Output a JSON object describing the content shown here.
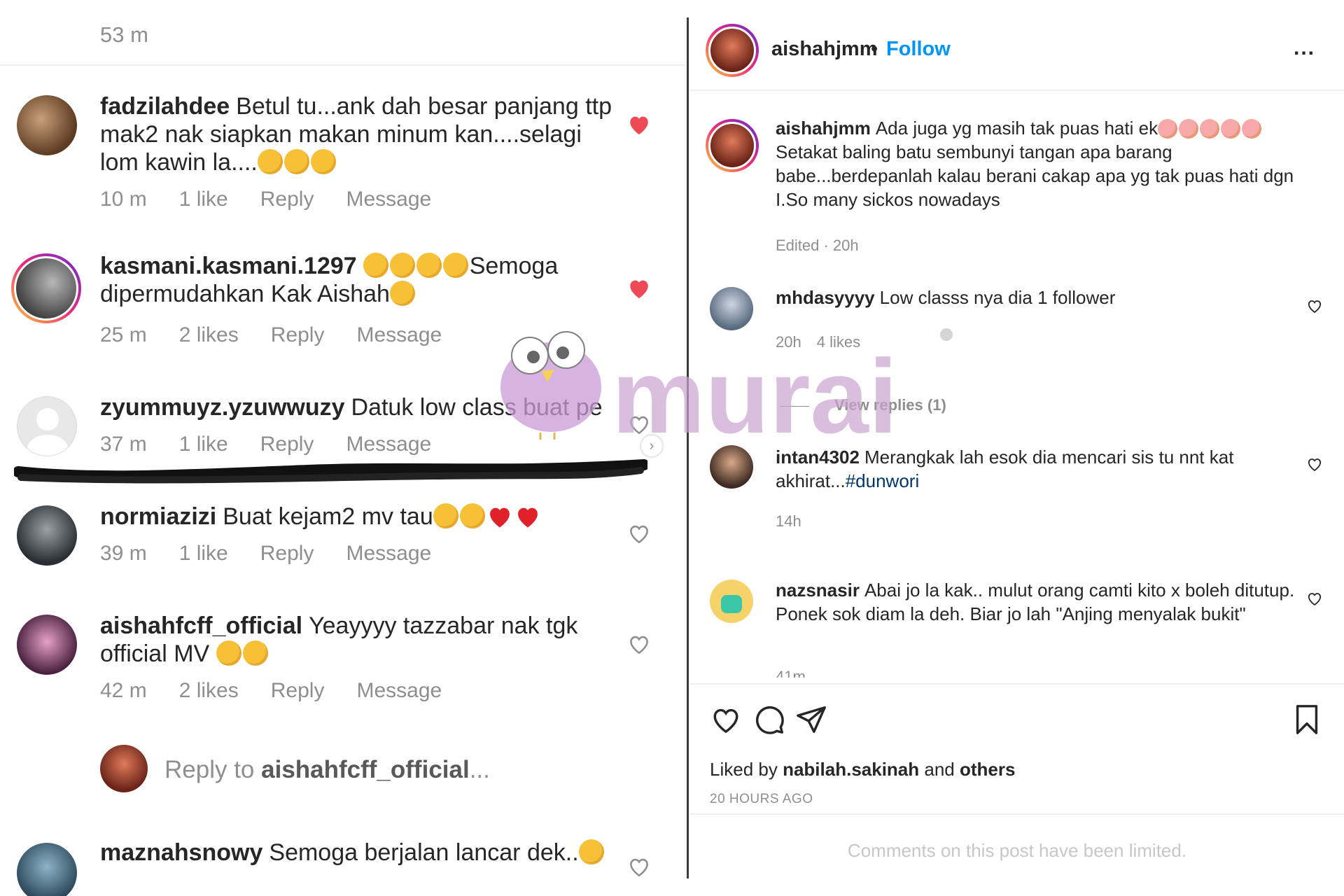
{
  "left_panel": {
    "top_timestamp": "53 m",
    "comments": [
      {
        "username": "fadzilahdee",
        "text": "Betul tu...ank dah besar panjang ttp mak2 nak siapkan makan minum kan....selagi lom kawin la....",
        "emojis": [
          "grinning-sweat",
          "grinning-sweat",
          "grinning-sweat"
        ],
        "time": "10 m",
        "likes": "1 like",
        "reply": "Reply",
        "message": "Message",
        "liked": true
      },
      {
        "username": "kasmani.kasmani.1297",
        "text": "Semoga dipermudahkan Kak Aishah",
        "emojis": [
          "grinning",
          "grinning-sweat",
          "grinning-sweat",
          "rofl",
          "grinning-sweat"
        ],
        "time": "25 m",
        "likes": "2 likes",
        "reply": "Reply",
        "message": "Message",
        "liked": true
      },
      {
        "username": "zyummuyz.yzuwwuzy",
        "text": "Datuk low class buat pe",
        "time": "37 m",
        "likes": "1 like",
        "reply": "Reply",
        "message": "Message",
        "liked": false
      },
      {
        "username": "normiazizi",
        "text": "Buat kejam2 mv tau",
        "emojis": [
          "grinning-sweat",
          "grinning-sweat",
          "red-heart",
          "red-heart"
        ],
        "time": "39 m",
        "likes": "1 like",
        "reply": "Reply",
        "message": "Message",
        "liked": false
      },
      {
        "username": "aishahfcff_official",
        "text": "Yeayyyy tazzabar nak tgk official MV",
        "emojis": [
          "heart-eyes",
          "heart-eyes"
        ],
        "time": "42 m",
        "likes": "2 likes",
        "reply": "Reply",
        "message": "Message",
        "liked": false
      },
      {
        "username": "maznahsnowy",
        "text": "Semoga berjalan lancar dek..",
        "emojis": [
          "thumbs-up"
        ],
        "liked": false
      }
    ],
    "reply_prompt": {
      "prefix": "Reply to ",
      "username": "aishahfcff_official",
      "suffix": "..."
    }
  },
  "right_panel": {
    "header": {
      "username": "aishahjmm",
      "separator": "•",
      "follow": "Follow",
      "more": "..."
    },
    "caption": {
      "username": "aishahjmm",
      "text": "Ada juga yg masih tak puas hati ek",
      "emojis": [
        "hugging-hearts",
        "hugging-hearts",
        "hugging-hearts",
        "hugging-hearts",
        "hugging-hearts"
      ],
      "text2": "Setakat baling batu sembunyi tangan apa barang babe...berdepanlah kalau berani cakap apa yg tak puas hati dgn I.So many sickos nowadays",
      "meta": "Edited · 20h"
    },
    "comments": [
      {
        "username": "mhdasyyyy",
        "text": "Low classs nya dia 1 follower",
        "time": "20h",
        "likes": "4 likes"
      },
      {
        "username": "intan4302",
        "text": "Merangkak lah esok dia mencari sis tu nnt kat akhirat...",
        "hashtag": "#dunwori",
        "time": "14h"
      },
      {
        "username": "nazsnasir",
        "text": "Abai jo la kak.. mulut orang camti kito x boleh ditutup. Ponek sok diam la deh. Biar jo lah \"Anjing menyalak bukit\"",
        "time": "41m"
      }
    ],
    "view_replies": "View replies (1)",
    "liked_by": {
      "prefix": "Liked by ",
      "user": "nabilah.sakinah",
      "middle": " and ",
      "others": "others"
    },
    "time_ago": "20 HOURS AGO",
    "limited_notice": "Comments on this post have been limited."
  },
  "watermark": {
    "text": "murai"
  },
  "colors": {
    "follow": "#0095f6",
    "liked_heart": "#ed4956",
    "meta_gray": "#8e8e8e",
    "watermark": "#c9a3cf"
  }
}
